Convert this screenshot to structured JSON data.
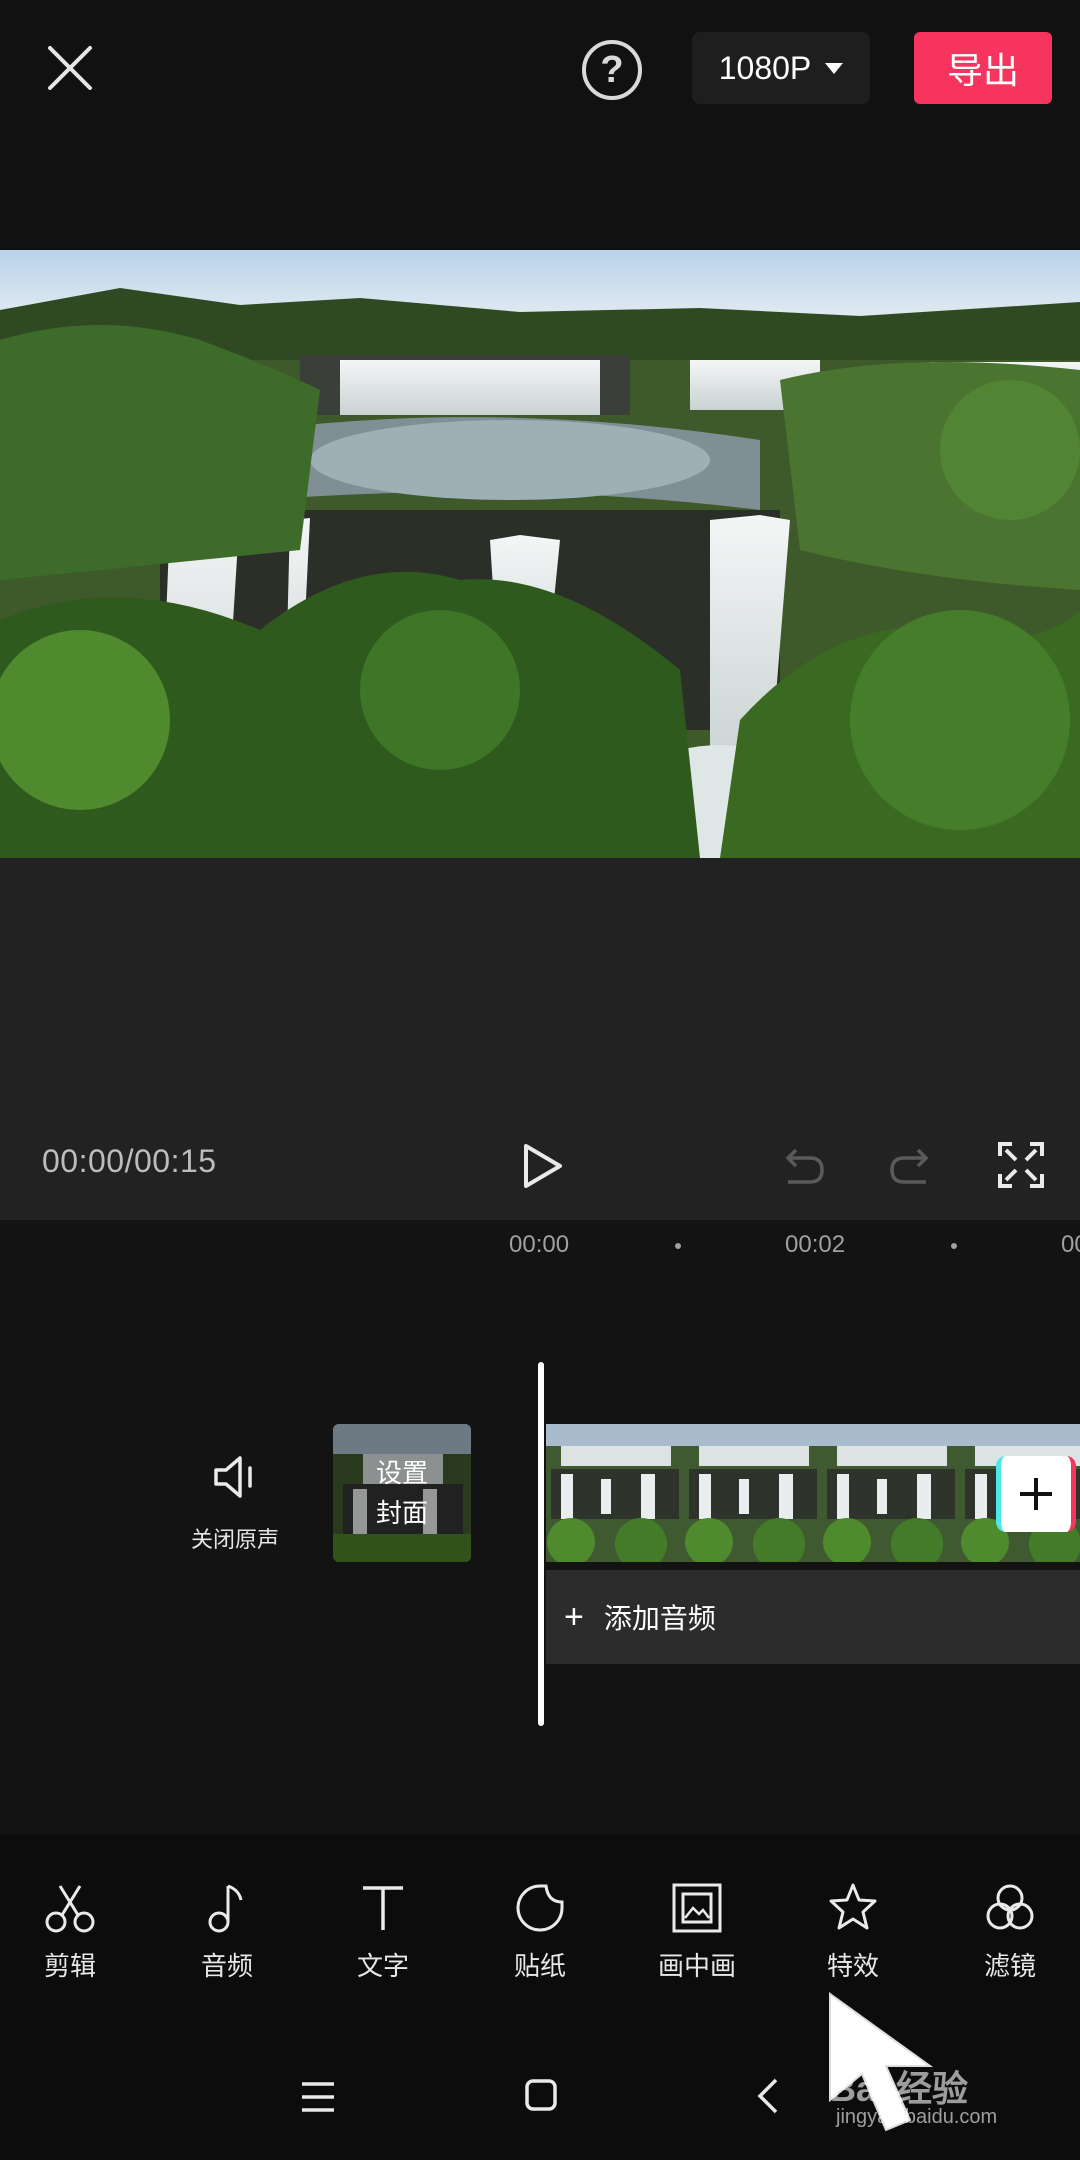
{
  "topbar": {
    "close_icon": "close-icon",
    "help_icon": "help-icon",
    "help_glyph": "?",
    "resolution": "1080P",
    "export_label": "导出",
    "accent": "#f7345e"
  },
  "player": {
    "time": "00:00/00:15",
    "icons": [
      "play-icon",
      "undo-icon",
      "redo-icon",
      "fullscreen-icon"
    ]
  },
  "timeline": {
    "ruler": [
      "00:00",
      "00:02",
      "00"
    ],
    "mute_label": "关闭原声",
    "cover_line1": "设置",
    "cover_line2": "封面",
    "add_audio_label": "添加音频",
    "add_audio_plus": "+"
  },
  "toolbar": {
    "items": [
      {
        "label": "剪辑",
        "icon": "scissors-icon"
      },
      {
        "label": "音频",
        "icon": "music-note-icon"
      },
      {
        "label": "文字",
        "icon": "text-icon"
      },
      {
        "label": "贴纸",
        "icon": "sticker-icon"
      },
      {
        "label": "画中画",
        "icon": "picture-in-picture-icon"
      },
      {
        "label": "特效",
        "icon": "star-effects-icon"
      },
      {
        "label": "滤镜",
        "icon": "filter-icon"
      }
    ]
  },
  "navbar": {
    "icons": [
      "menu-icon",
      "home-icon",
      "back-icon"
    ]
  },
  "watermark": {
    "text": "Bai 经验",
    "sub": "jingyan.baidu.com"
  }
}
